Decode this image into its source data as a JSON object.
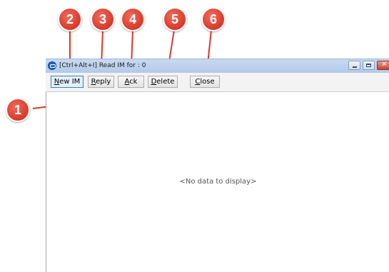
{
  "window": {
    "title": "[Ctrl+Alt+I] Read IM for : 0"
  },
  "toolbar": {
    "buttons": [
      {
        "mnemonic": "N",
        "rest": "ew IM"
      },
      {
        "mnemonic": "R",
        "rest": "eply"
      },
      {
        "mnemonic": "A",
        "rest": "ck"
      },
      {
        "mnemonic": "D",
        "rest": "elete"
      },
      {
        "mnemonic": "C",
        "rest": "lose"
      }
    ]
  },
  "content": {
    "empty_message": "<No data to display>"
  },
  "callouts": [
    "1",
    "2",
    "3",
    "4",
    "5",
    "6"
  ],
  "colors": {
    "callout": "#d8392a",
    "title_bar": "#b3c9e8",
    "focus_border": "#2c7fd6"
  }
}
